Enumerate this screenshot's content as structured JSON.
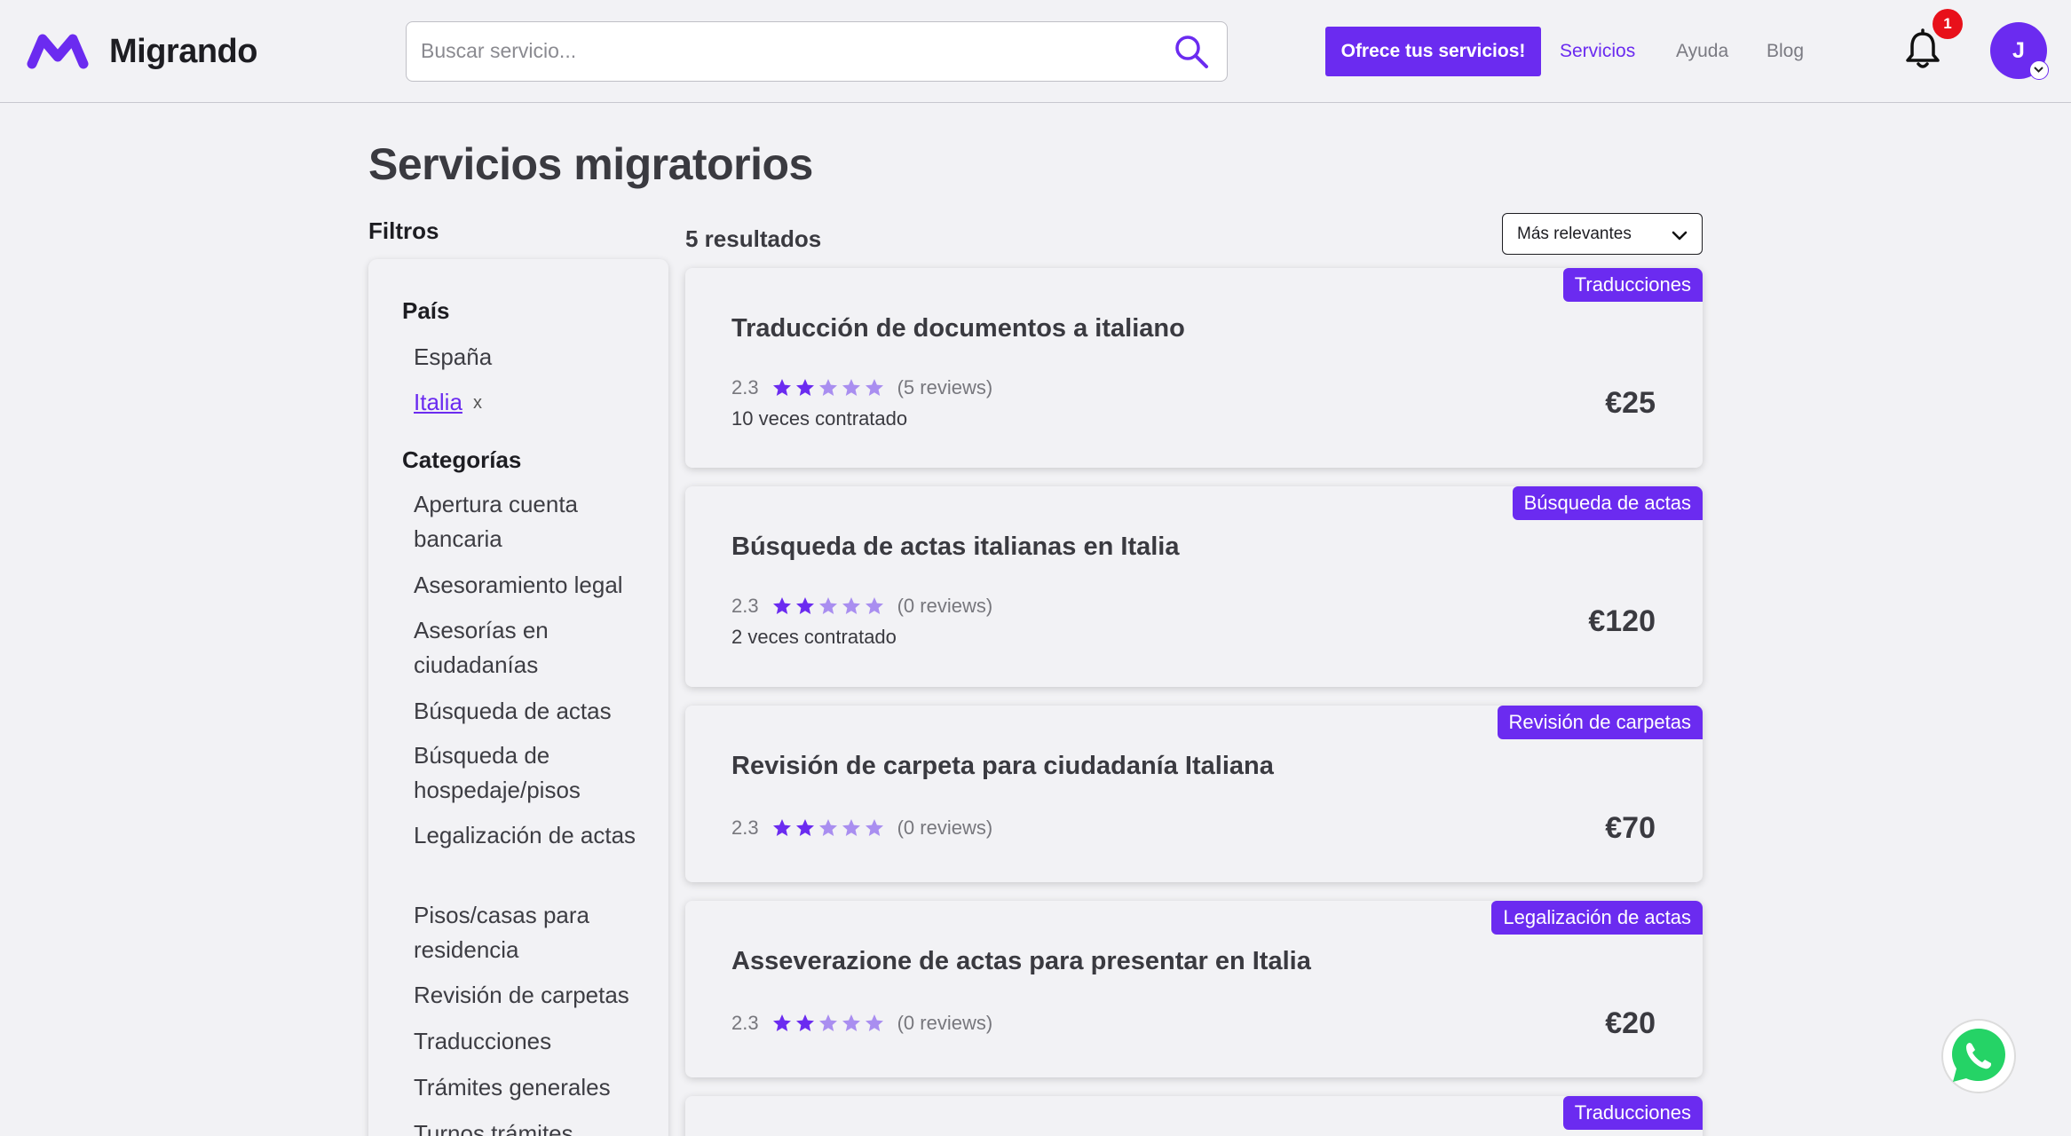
{
  "header": {
    "brand": "Migrando",
    "search_placeholder": "Buscar servicio...",
    "cta_label": "Ofrece tus servicios!",
    "nav": [
      "Servicios",
      "Ayuda",
      "Blog"
    ],
    "notification_count": "1",
    "avatar_initial": "J"
  },
  "page": {
    "title": "Servicios migratorios"
  },
  "filters": {
    "title": "Filtros",
    "country_heading": "País",
    "countries": [
      "España",
      "Italia"
    ],
    "selected_country_remove": "x",
    "categories_heading": "Categorías",
    "categories": [
      "Apertura cuenta bancaria",
      "Asesoramiento legal",
      "Asesorías en ciudadanías",
      "Búsqueda de actas",
      "Búsqueda de hospedaje/pisos",
      "Legalización de actas",
      "Pisos/casas para residencia",
      "Revisión de carpetas",
      "Traducciones",
      "Trámites generales",
      "Turnos trámites"
    ]
  },
  "results": {
    "count_label": "5 resultados",
    "sort_label": "Más relevantes",
    "items": [
      {
        "category": "Traducciones",
        "title": "Traducción de documentos a italiano",
        "rating": "2.3",
        "stars_filled": 2,
        "reviews": "(5 reviews)",
        "hired": "10 veces contratado",
        "price": "€25"
      },
      {
        "category": "Búsqueda de actas",
        "title": "Búsqueda de actas italianas en Italia",
        "rating": "2.3",
        "stars_filled": 2,
        "reviews": "(0 reviews)",
        "hired": "2 veces contratado",
        "price": "€120"
      },
      {
        "category": "Revisión de carpetas",
        "title": "Revisión de carpeta para ciudadanía Italiana",
        "rating": "2.3",
        "stars_filled": 2,
        "reviews": "(0 reviews)",
        "price": "€70"
      },
      {
        "category": "Legalización de actas",
        "title": "Asseverazione de actas para presentar en Italia",
        "rating": "2.3",
        "stars_filled": 2,
        "reviews": "(0 reviews)",
        "price": "€20"
      },
      {
        "category": "Traducciones"
      }
    ]
  },
  "colors": {
    "accent": "#6b2bf0",
    "star_filled": "#6b2bf0",
    "star_empty": "#a98ef0",
    "badge_alert": "#e8101a",
    "whatsapp": "#25d366"
  }
}
